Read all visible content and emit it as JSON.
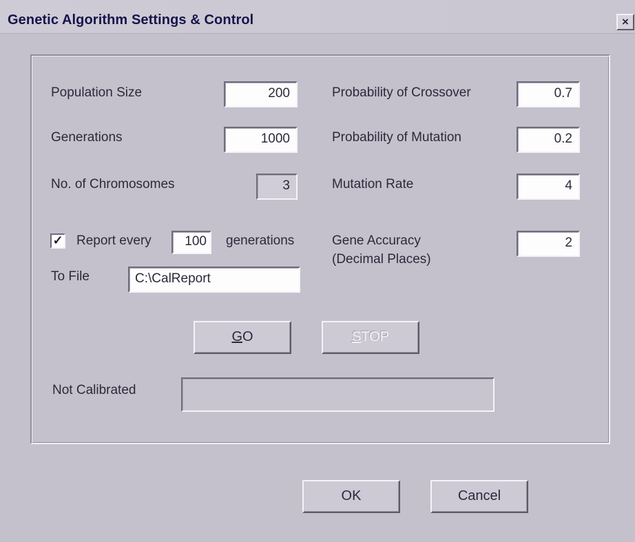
{
  "window": {
    "title": "Genetic Algorithm Settings & Control",
    "close_glyph": "×"
  },
  "settings": {
    "population_size_label": "Population Size",
    "population_size_value": "200",
    "generations_label": "Generations",
    "generations_value": "1000",
    "chromosomes_label": "No. of Chromosomes",
    "chromosomes_value": "3",
    "crossover_label": "Probability of Crossover",
    "crossover_value": "0.7",
    "mutation_prob_label": "Probability of Mutation",
    "mutation_prob_value": "0.2",
    "mutation_rate_label": "Mutation Rate",
    "mutation_rate_value": "4",
    "gene_accuracy_label_line1": "Gene Accuracy",
    "gene_accuracy_label_line2": "(Decimal Places)",
    "gene_accuracy_value": "2"
  },
  "report": {
    "checked": true,
    "check_glyph": "✓",
    "report_every_label": "Report every",
    "report_every_value": "100",
    "generations_suffix": "generations",
    "to_file_label": "To File",
    "to_file_value": "C:\\CalReport"
  },
  "controls": {
    "go_label": "GO",
    "stop_label": "STOP",
    "status_label": "Not Calibrated",
    "status_value": ""
  },
  "footer": {
    "ok_label": "OK",
    "cancel_label": "Cancel"
  }
}
